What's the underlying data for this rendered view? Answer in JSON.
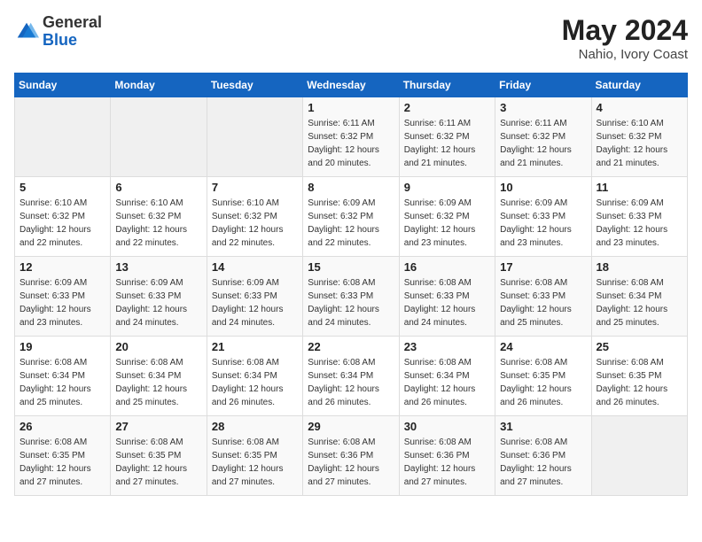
{
  "logo": {
    "general": "General",
    "blue": "Blue"
  },
  "header": {
    "month_year": "May 2024",
    "location": "Nahio, Ivory Coast"
  },
  "weekdays": [
    "Sunday",
    "Monday",
    "Tuesday",
    "Wednesday",
    "Thursday",
    "Friday",
    "Saturday"
  ],
  "weeks": [
    [
      {
        "day": "",
        "empty": true
      },
      {
        "day": "",
        "empty": true
      },
      {
        "day": "",
        "empty": true
      },
      {
        "day": "1",
        "sunrise": "6:11 AM",
        "sunset": "6:32 PM",
        "daylight": "12 hours and 20 minutes."
      },
      {
        "day": "2",
        "sunrise": "6:11 AM",
        "sunset": "6:32 PM",
        "daylight": "12 hours and 21 minutes."
      },
      {
        "day": "3",
        "sunrise": "6:11 AM",
        "sunset": "6:32 PM",
        "daylight": "12 hours and 21 minutes."
      },
      {
        "day": "4",
        "sunrise": "6:10 AM",
        "sunset": "6:32 PM",
        "daylight": "12 hours and 21 minutes."
      }
    ],
    [
      {
        "day": "5",
        "sunrise": "6:10 AM",
        "sunset": "6:32 PM",
        "daylight": "12 hours and 22 minutes."
      },
      {
        "day": "6",
        "sunrise": "6:10 AM",
        "sunset": "6:32 PM",
        "daylight": "12 hours and 22 minutes."
      },
      {
        "day": "7",
        "sunrise": "6:10 AM",
        "sunset": "6:32 PM",
        "daylight": "12 hours and 22 minutes."
      },
      {
        "day": "8",
        "sunrise": "6:09 AM",
        "sunset": "6:32 PM",
        "daylight": "12 hours and 22 minutes."
      },
      {
        "day": "9",
        "sunrise": "6:09 AM",
        "sunset": "6:32 PM",
        "daylight": "12 hours and 23 minutes."
      },
      {
        "day": "10",
        "sunrise": "6:09 AM",
        "sunset": "6:33 PM",
        "daylight": "12 hours and 23 minutes."
      },
      {
        "day": "11",
        "sunrise": "6:09 AM",
        "sunset": "6:33 PM",
        "daylight": "12 hours and 23 minutes."
      }
    ],
    [
      {
        "day": "12",
        "sunrise": "6:09 AM",
        "sunset": "6:33 PM",
        "daylight": "12 hours and 23 minutes."
      },
      {
        "day": "13",
        "sunrise": "6:09 AM",
        "sunset": "6:33 PM",
        "daylight": "12 hours and 24 minutes."
      },
      {
        "day": "14",
        "sunrise": "6:09 AM",
        "sunset": "6:33 PM",
        "daylight": "12 hours and 24 minutes."
      },
      {
        "day": "15",
        "sunrise": "6:08 AM",
        "sunset": "6:33 PM",
        "daylight": "12 hours and 24 minutes."
      },
      {
        "day": "16",
        "sunrise": "6:08 AM",
        "sunset": "6:33 PM",
        "daylight": "12 hours and 24 minutes."
      },
      {
        "day": "17",
        "sunrise": "6:08 AM",
        "sunset": "6:33 PM",
        "daylight": "12 hours and 25 minutes."
      },
      {
        "day": "18",
        "sunrise": "6:08 AM",
        "sunset": "6:34 PM",
        "daylight": "12 hours and 25 minutes."
      }
    ],
    [
      {
        "day": "19",
        "sunrise": "6:08 AM",
        "sunset": "6:34 PM",
        "daylight": "12 hours and 25 minutes."
      },
      {
        "day": "20",
        "sunrise": "6:08 AM",
        "sunset": "6:34 PM",
        "daylight": "12 hours and 25 minutes."
      },
      {
        "day": "21",
        "sunrise": "6:08 AM",
        "sunset": "6:34 PM",
        "daylight": "12 hours and 26 minutes."
      },
      {
        "day": "22",
        "sunrise": "6:08 AM",
        "sunset": "6:34 PM",
        "daylight": "12 hours and 26 minutes."
      },
      {
        "day": "23",
        "sunrise": "6:08 AM",
        "sunset": "6:34 PM",
        "daylight": "12 hours and 26 minutes."
      },
      {
        "day": "24",
        "sunrise": "6:08 AM",
        "sunset": "6:35 PM",
        "daylight": "12 hours and 26 minutes."
      },
      {
        "day": "25",
        "sunrise": "6:08 AM",
        "sunset": "6:35 PM",
        "daylight": "12 hours and 26 minutes."
      }
    ],
    [
      {
        "day": "26",
        "sunrise": "6:08 AM",
        "sunset": "6:35 PM",
        "daylight": "12 hours and 27 minutes."
      },
      {
        "day": "27",
        "sunrise": "6:08 AM",
        "sunset": "6:35 PM",
        "daylight": "12 hours and 27 minutes."
      },
      {
        "day": "28",
        "sunrise": "6:08 AM",
        "sunset": "6:35 PM",
        "daylight": "12 hours and 27 minutes."
      },
      {
        "day": "29",
        "sunrise": "6:08 AM",
        "sunset": "6:36 PM",
        "daylight": "12 hours and 27 minutes."
      },
      {
        "day": "30",
        "sunrise": "6:08 AM",
        "sunset": "6:36 PM",
        "daylight": "12 hours and 27 minutes."
      },
      {
        "day": "31",
        "sunrise": "6:08 AM",
        "sunset": "6:36 PM",
        "daylight": "12 hours and 27 minutes."
      },
      {
        "day": "",
        "empty": true
      }
    ]
  ],
  "labels": {
    "sunrise": "Sunrise:",
    "sunset": "Sunset:",
    "daylight": "Daylight:"
  }
}
